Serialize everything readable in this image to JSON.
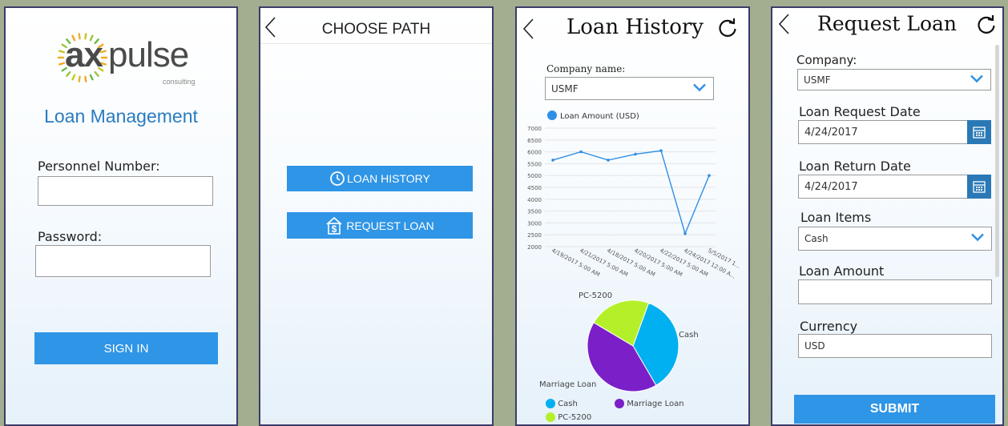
{
  "login": {
    "logo_text_ax": "ax",
    "logo_text_pulse": "pulse",
    "logo_sub": "consulting",
    "title": "Loan Management",
    "personnel_label": "Personnel Number:",
    "personnel_value": "",
    "password_label": "Password:",
    "password_value": "",
    "signin_label": "SIGN IN"
  },
  "path": {
    "title": "CHOOSE PATH",
    "loan_history_label": "LOAN HISTORY",
    "request_loan_label": "REQUEST LOAN"
  },
  "history": {
    "title": "Loan History",
    "company_label": "Company name:",
    "company_value": "USMF",
    "chart_data": [
      {
        "type": "line",
        "series": [
          {
            "name": "Loan Amount  (USD)",
            "values": [
              5650,
              6000,
              5650,
              5900,
              6050,
              2550,
              5000
            ]
          }
        ],
        "yticks": [
          "7000",
          "6500",
          "6000",
          "5500",
          "5000",
          "4500",
          "4000",
          "3500",
          "3000",
          "2500",
          "2000"
        ],
        "ylim": [
          2000,
          7000
        ],
        "xlabels": [
          "4/19/2017 5:00 AM",
          "4/21/2017 5:00 AM",
          "4/18/2017 5:00 AM",
          "4/20/2017 5:00 AM",
          "4/22/2017 5:00 AM",
          "4/24/2017 12:00 A...",
          "5/5/2017 1..."
        ],
        "color": "#2f8fe6"
      },
      {
        "type": "pie",
        "slices": [
          {
            "name": "Cash",
            "value": 0.36,
            "color": "#00b0f0"
          },
          {
            "name": "Marriage Loan",
            "value": 0.42,
            "color": "#7b1fc8"
          },
          {
            "name": "PC-5200",
            "value": 0.22,
            "color": "#b4f02a"
          }
        ],
        "legend": [
          {
            "label": "Cash",
            "color": "#00b0f0"
          },
          {
            "label": "Marriage Loan",
            "color": "#7b1fc8"
          },
          {
            "label": "PC-5200",
            "color": "#b4f02a"
          }
        ]
      }
    ]
  },
  "request": {
    "title": "Request Loan",
    "company_label": "Company:",
    "company_value": "USMF",
    "request_date_label": "Loan Request Date",
    "request_date_value": "4/24/2017",
    "return_date_label": "Loan Return Date",
    "return_date_value": "4/24/2017",
    "items_label": "Loan Items",
    "items_value": "Cash",
    "amount_label": "Loan Amount",
    "amount_value": "",
    "currency_label": "Currency",
    "currency_value": "USD",
    "submit_label": "SUBMIT"
  }
}
